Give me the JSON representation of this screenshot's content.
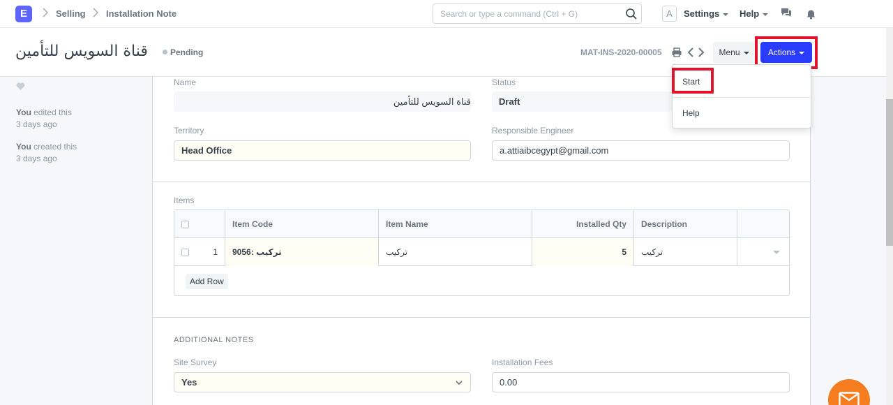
{
  "navbar": {
    "logo": "E",
    "breadcrumbs": [
      "Selling",
      "Installation Note"
    ],
    "search_placeholder": "Search or type a command (Ctrl + G)",
    "avatar_letter": "A",
    "settings_label": "Settings",
    "help_label": "Help"
  },
  "page_head": {
    "title": "قناة السويس للتأمين",
    "status": "Pending",
    "doc_name": "MAT-INS-2020-00005",
    "menu_label": "Menu",
    "actions_label": "Actions"
  },
  "dropdown": {
    "items": [
      "Start",
      "Help"
    ]
  },
  "sidebar": {
    "activity": [
      {
        "who": "You",
        "action": " edited this",
        "when": "3 days ago"
      },
      {
        "who": "You",
        "action": " created this",
        "when": "3 days ago"
      }
    ]
  },
  "form": {
    "name_label": "Name",
    "name_value": "قناة السويس للتأمين",
    "status_label": "Status",
    "status_value": "Draft",
    "territory_label": "Territory",
    "territory_value": "Head Office",
    "engineer_label": "Responsible Engineer",
    "engineer_value": "a.attiaibcegypt@gmail.com",
    "items_label": "Items",
    "additional_notes_label": "ADDITIONAL NOTES",
    "site_survey_label": "Site Survey",
    "site_survey_value": "Yes",
    "installation_fees_label": "Installation Fees",
    "installation_fees_value": "0.00"
  },
  "items_table": {
    "columns": [
      "Item Code",
      "Item Name",
      "Installed Qty",
      "Description"
    ],
    "rows": [
      {
        "idx": "1",
        "item_code": "9056: تركيب",
        "item_name": "تركيب",
        "installed_qty": "5",
        "description": "تركيب"
      }
    ],
    "add_row_label": "Add Row"
  },
  "colors": {
    "primary": "#5e64ff",
    "actions_button": "#2a3cff",
    "highlight_outline": "#e0132a",
    "chat_button": "#f57c1f"
  }
}
